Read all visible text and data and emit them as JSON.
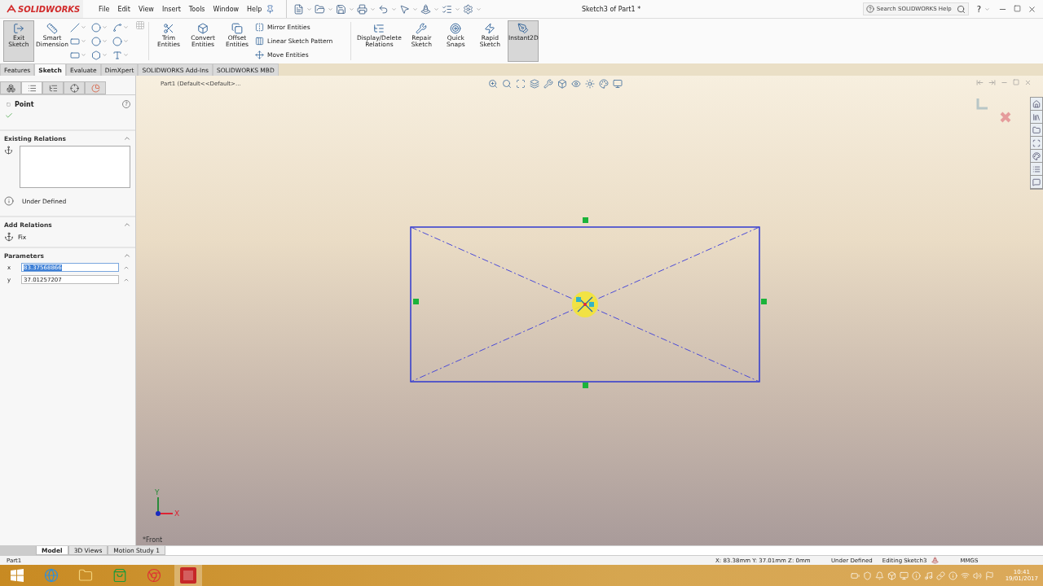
{
  "titlebar": {
    "brand": "SOLIDWORKS",
    "menu": [
      "File",
      "Edit",
      "View",
      "Insert",
      "Tools",
      "Window",
      "Help"
    ],
    "title": "Sketch3 of Part1 *",
    "search": {
      "placeholder": "Search SOLIDWORKS Help"
    },
    "help": "?"
  },
  "ribbon": {
    "left": [
      {
        "label": "Exit Sketch",
        "selected": true
      },
      {
        "label": "Smart Dimension",
        "selected": false
      }
    ],
    "entities": [
      {
        "label": "Trim Entities"
      },
      {
        "label": "Convert Entities"
      },
      {
        "label": "Offset Entities"
      }
    ],
    "list": [
      "Mirror Entities",
      "Linear Sketch Pattern",
      "Move Entities"
    ],
    "right": [
      {
        "label": "Display/Delete Relations",
        "selected": false
      },
      {
        "label": "Repair Sketch",
        "selected": false
      },
      {
        "label": "Quick Snaps",
        "selected": false
      },
      {
        "label": "Rapid Sketch",
        "selected": false
      },
      {
        "label": "Instant2D",
        "selected": true
      }
    ]
  },
  "command_tabs": [
    {
      "label": "Features",
      "selected": false
    },
    {
      "label": "Sketch",
      "selected": true
    },
    {
      "label": "Evaluate",
      "selected": false
    },
    {
      "label": "DimXpert",
      "selected": false
    },
    {
      "label": "SOLIDWORKS Add-Ins",
      "selected": false
    },
    {
      "label": "SOLIDWORKS MBD",
      "selected": false
    }
  ],
  "panel": {
    "tabs": [
      {
        "selected": false
      },
      {
        "selected": true
      },
      {
        "selected": false
      },
      {
        "selected": false
      },
      {
        "selected": false
      }
    ],
    "title": "Point",
    "help": "?",
    "existing_relations": {
      "title": "Existing Relations",
      "status": "Under Defined"
    },
    "add_relations": {
      "title": "Add Relations",
      "items": [
        "Fix"
      ]
    },
    "parameters": {
      "title": "Parameters",
      "fields": [
        {
          "axis": "x",
          "value": "83.37568866",
          "highlighted": true
        },
        {
          "axis": "y",
          "value": "37.01257207",
          "highlighted": false
        }
      ]
    }
  },
  "viewport": {
    "breadcrumb": "Part1  (Default<<Default>...",
    "view_name": "*Front",
    "triad": {
      "y": "Y",
      "x": "X"
    }
  },
  "bottom_tabs": [
    {
      "label": "Model",
      "selected": true
    },
    {
      "label": "3D Views",
      "selected": false
    },
    {
      "label": "Motion Study 1",
      "selected": false
    }
  ],
  "status_bar": {
    "document": "Part1",
    "coordinates": "X: 83.38mm Y: 37.01mm Z: 0mm",
    "state": "Under Defined",
    "mode": "Editing Sketch3",
    "units": "MMGS"
  },
  "taskbar": {
    "time": "10:41",
    "date": "19/01/2017"
  }
}
